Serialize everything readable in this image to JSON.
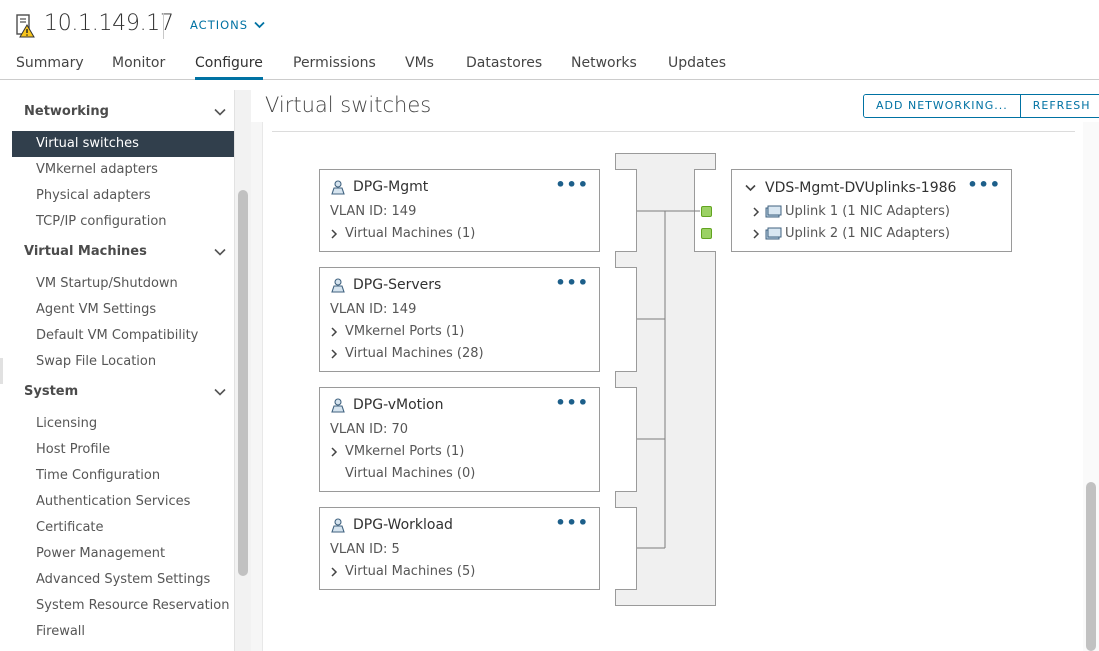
{
  "header": {
    "host_name": "10.1.149.17",
    "actions_label": "ACTIONS"
  },
  "tabs": [
    {
      "label": "Summary"
    },
    {
      "label": "Monitor"
    },
    {
      "label": "Configure",
      "active": true
    },
    {
      "label": "Permissions"
    },
    {
      "label": "VMs"
    },
    {
      "label": "Datastores"
    },
    {
      "label": "Networks"
    },
    {
      "label": "Updates"
    }
  ],
  "sidebar": {
    "sections": [
      {
        "label": "Networking",
        "items": [
          "Virtual switches",
          "VMkernel adapters",
          "Physical adapters",
          "TCP/IP configuration"
        ]
      },
      {
        "label": "Virtual Machines",
        "items": [
          "VM Startup/Shutdown",
          "Agent VM Settings",
          "Default VM Compatibility",
          "Swap File Location"
        ]
      },
      {
        "label": "System",
        "items": [
          "Licensing",
          "Host Profile",
          "Time Configuration",
          "Authentication Services",
          "Certificate",
          "Power Management",
          "Advanced System Settings",
          "System Resource Reservation",
          "Firewall"
        ]
      }
    ],
    "active_item": "Virtual switches"
  },
  "main": {
    "title": "Virtual switches",
    "add_networking_label": "ADD NETWORKING...",
    "refresh_label": "REFRESH"
  },
  "port_groups": [
    {
      "name": "DPG-Mgmt",
      "vlan": "VLAN ID: 149",
      "rows": [
        {
          "text": "Virtual Machines (1)",
          "expandable": true
        }
      ]
    },
    {
      "name": "DPG-Servers",
      "vlan": "VLAN ID: 149",
      "rows": [
        {
          "text": "VMkernel Ports (1)",
          "expandable": true
        },
        {
          "text": "Virtual Machines (28)",
          "expandable": true
        }
      ]
    },
    {
      "name": "DPG-vMotion",
      "vlan": "VLAN ID: 70",
      "rows": [
        {
          "text": "VMkernel Ports (1)",
          "expandable": true
        },
        {
          "text": "Virtual Machines (0)",
          "expandable": false
        }
      ]
    },
    {
      "name": "DPG-Workload",
      "vlan": "VLAN ID: 5",
      "rows": [
        {
          "text": "Virtual Machines (5)",
          "expandable": true
        }
      ]
    }
  ],
  "uplinks": {
    "name": "VDS-Mgmt-DVUplinks-1986",
    "items": [
      "Uplink 1 (1 NIC Adapters)",
      "Uplink 2 (1 NIC Adapters)"
    ]
  },
  "colors": {
    "accent": "#0072a3",
    "sidebar_active_bg": "#313f4c",
    "port_active": "#9bd164"
  },
  "icons": [
    "host-warning-icon",
    "chevron-down-icon",
    "portgroup-icon",
    "more-icon",
    "caret-right-icon",
    "nic-adapter-icon"
  ]
}
